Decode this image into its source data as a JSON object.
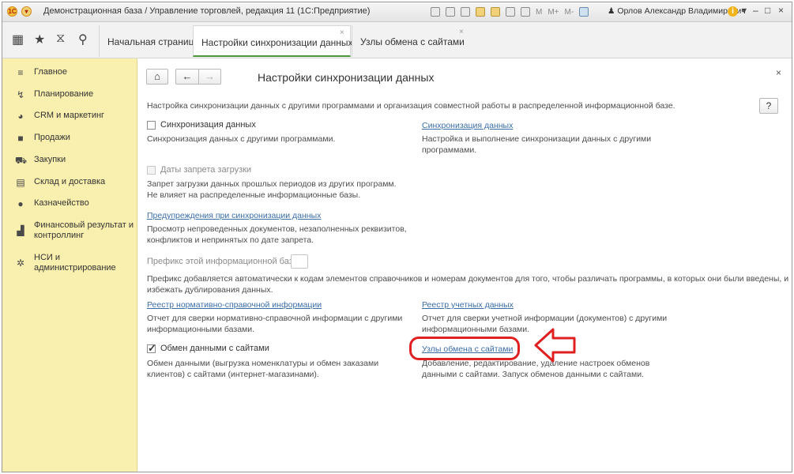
{
  "window": {
    "title": "Демонстрационная база / Управление торговлей, редакция 11  (1С:Предприятие)",
    "toolbar_text": [
      "M",
      "M+",
      "M-"
    ],
    "user": "Орлов Александр Владимирович",
    "controls": [
      "i",
      "▾",
      "–",
      "□",
      "×"
    ]
  },
  "tabs": [
    {
      "label": "Начальная страница",
      "active": false
    },
    {
      "label": "Настройки синхронизации данных",
      "active": true,
      "close": "×"
    },
    {
      "label": "Узлы обмена с сайтами",
      "active": false,
      "close": "×"
    }
  ],
  "sidebar": {
    "items": [
      {
        "label": "Главное",
        "icon": "menu-lines-icon"
      },
      {
        "label": "Планирование",
        "icon": "planning-icon"
      },
      {
        "label": "CRM и маркетинг",
        "icon": "pie-chart-icon"
      },
      {
        "label": "Продажи",
        "icon": "shopping-bag-icon"
      },
      {
        "label": "Закупки",
        "icon": "cart-icon"
      },
      {
        "label": "Склад и доставка",
        "icon": "warehouse-icon"
      },
      {
        "label": "Казначейство",
        "icon": "coin-icon"
      },
      {
        "label": "Финансовый результат и контроллинг",
        "icon": "bar-chart-icon"
      },
      {
        "label": "НСИ и администрирование",
        "icon": "gear-icon"
      }
    ]
  },
  "page": {
    "title": "Настройки синхронизации данных",
    "close": "×",
    "help": "?",
    "intro": "Настройка синхронизации данных с другими программами и организация совместной работы в распределенной информационной базе.",
    "sync": {
      "label": "Синхронизация данных",
      "checked": false,
      "desc": "Синхронизация данных с другими программами."
    },
    "sync_link": {
      "label": "Синхронизация данных",
      "desc1": "Настройка и выполнение синхронизации данных с другими",
      "desc2": "программами."
    },
    "restrict": {
      "label": "Даты запрета загрузки",
      "desc1": "Запрет загрузки данных прошлых периодов из других программ.",
      "desc2": "Не влияет на распределенные информационные базы."
    },
    "warnings": {
      "label": "Предупреждения при синхронизации данных",
      "desc1": "Просмотр непроведенных документов, незаполненных реквизитов,",
      "desc2": "конфликтов и непринятых по дате запрета."
    },
    "prefix": {
      "label": "Префикс этой информационной базы:",
      "value": "",
      "desc1": "Префикс добавляется автоматически к кодам элементов справочников и номерам документов для того, чтобы различать программы, в которых они были введены, и",
      "desc2": "избежать дублирования данных."
    },
    "nsi_registry": {
      "label": "Реестр нормативно-справочной информации",
      "desc1": "Отчет для сверки нормативно-справочной информации с другими",
      "desc2": "информационными базами."
    },
    "docs_registry": {
      "label": "Реестр учетных данных",
      "desc1": "Отчет для сверки учетной информации (документов) с другими",
      "desc2": "информационными базами."
    },
    "site_exchange": {
      "label": "Обмен данными с сайтами",
      "checked": true,
      "desc1": "Обмен данными (выгрузка номенклатуры и обмен заказами",
      "desc2": "клиентов) с сайтами (интернет-магазинами)."
    },
    "site_nodes": {
      "label": "Узлы обмена с сайтами",
      "desc1": "Добавление, редактирование, удаление настроек обменов",
      "desc2": "данными с сайтами. Запуск обменов данными с сайтами."
    }
  },
  "colors": {
    "sidebar_bg": "#f9efae",
    "link": "#3a6ea8",
    "active_tab_underline": "#4a9a3a",
    "highlight": "#e02020"
  }
}
